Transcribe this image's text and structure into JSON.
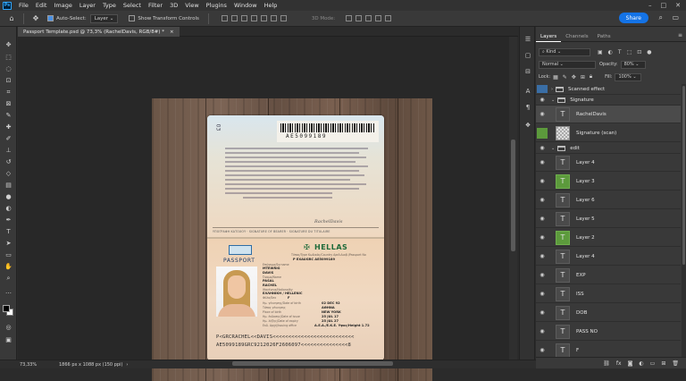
{
  "menubar": {
    "logo": "Ps",
    "items": [
      "File",
      "Edit",
      "Image",
      "Layer",
      "Type",
      "Select",
      "Filter",
      "3D",
      "View",
      "Plugins",
      "Window",
      "Help"
    ],
    "window_controls": [
      "–",
      "□",
      "✕"
    ]
  },
  "options": {
    "auto_select_label": "Auto-Select:",
    "auto_select_value": "Layer",
    "show_transform_label": "Show Transform Controls",
    "mode_3d_label": "3D Mode:",
    "share_label": "Share"
  },
  "document_tab": {
    "title": "Passport Template.psd @ 73,3% (RachelDavis, RGB/8#) *",
    "close": "×"
  },
  "panel": {
    "tabs": [
      "Layers",
      "Channels",
      "Paths"
    ],
    "active_tab": "Layers",
    "filter_label": "Kind",
    "blend_mode": "Normal",
    "opacity_label": "Opacity:",
    "opacity_value": "80%",
    "lock_label": "Lock:",
    "fill_label": "Fill:",
    "fill_value": "100%"
  },
  "layers": [
    {
      "name": "Scanned effect",
      "kind": "group",
      "visible": false
    },
    {
      "name": "Signature",
      "kind": "group",
      "visible": true
    },
    {
      "name": "RachelDavis",
      "kind": "text",
      "visible": true,
      "selected": true
    },
    {
      "name": "Signature (scan)",
      "kind": "image",
      "visible": false
    },
    {
      "name": "edit",
      "kind": "group",
      "visible": true
    },
    {
      "name": "Layer 4",
      "kind": "text",
      "visible": true
    },
    {
      "name": "Layer 3",
      "kind": "text",
      "visible": true
    },
    {
      "name": "Layer 6",
      "kind": "text",
      "visible": true
    },
    {
      "name": "Layer 5",
      "kind": "text",
      "visible": true
    },
    {
      "name": "Layer 2",
      "kind": "text",
      "visible": true
    },
    {
      "name": "Layer 4",
      "kind": "text",
      "visible": true
    },
    {
      "name": "EXP",
      "kind": "text",
      "visible": true
    },
    {
      "name": "ISS",
      "kind": "text",
      "visible": true
    },
    {
      "name": "DOB",
      "kind": "text",
      "visible": true
    },
    {
      "name": "PASS NO",
      "kind": "text",
      "visible": true
    },
    {
      "name": "F",
      "kind": "text",
      "visible": true
    }
  ],
  "status": {
    "zoom": "73,33%",
    "info": "1866 px x 1088 px (150 ppi)",
    "arrow": "›"
  },
  "passport": {
    "page_number": "03",
    "barcode_number": "AE5099189",
    "signature": "RachelDavis",
    "signature_caption": "ΥΠΟΓΡΑΦΗ ΚΑΤΟΧΟΥ · SIGNATURE OF BEARER · SIGNATURE DU TITULAIRE",
    "country": "HELLAS",
    "passport_label": "PASSPORT",
    "header_fields": "Τύπος/Type     Κωδικός/Country     Αριθ.Διαβ./Passport No",
    "header_values": "P     EXAUGRC     AE5099189",
    "fields": [
      {
        "label": "Επώνυμο/Surname",
        "value": "MTEWRIG"
      },
      {
        "label": "",
        "value": "DAVIS"
      },
      {
        "label": "Όνομα/Name",
        "value": "PASAL"
      },
      {
        "label": "",
        "value": "RACHEL"
      },
      {
        "label": "Ιθαγένεια/Nationality",
        "value": "ΕΛΛΗΝΙΚΗ / HELLENIC"
      },
      {
        "label": "Φύλο/Sex",
        "value": "F"
      },
      {
        "label": "Ημ. γέννησης/Date of birth",
        "value": "02 DEC 92"
      },
      {
        "label": "Τόπος γέννησης",
        "value": "ΑΘΗΝΑ"
      },
      {
        "label": "Place of birth",
        "value": "NEW YORK"
      },
      {
        "label": "Ημ. έκδοσης/Date of issue",
        "value": "25 JUL 17"
      },
      {
        "label": "Ημ. λήξης/Date of expiry",
        "value": "25 JUL 27"
      },
      {
        "label": "Εκδ. Αρχή/Issuing office",
        "value": "A.E.A./Ε.Κ.Ε.   Υψος/Height 1.72"
      }
    ],
    "mrz_line1": "P<GRCRACHEL<<DAVIS<<<<<<<<<<<<<<<<<<<<<<<<<<",
    "mrz_line2": "AE5099189GRC9212026F2606097<<<<<<<<<<<<<<<8"
  }
}
